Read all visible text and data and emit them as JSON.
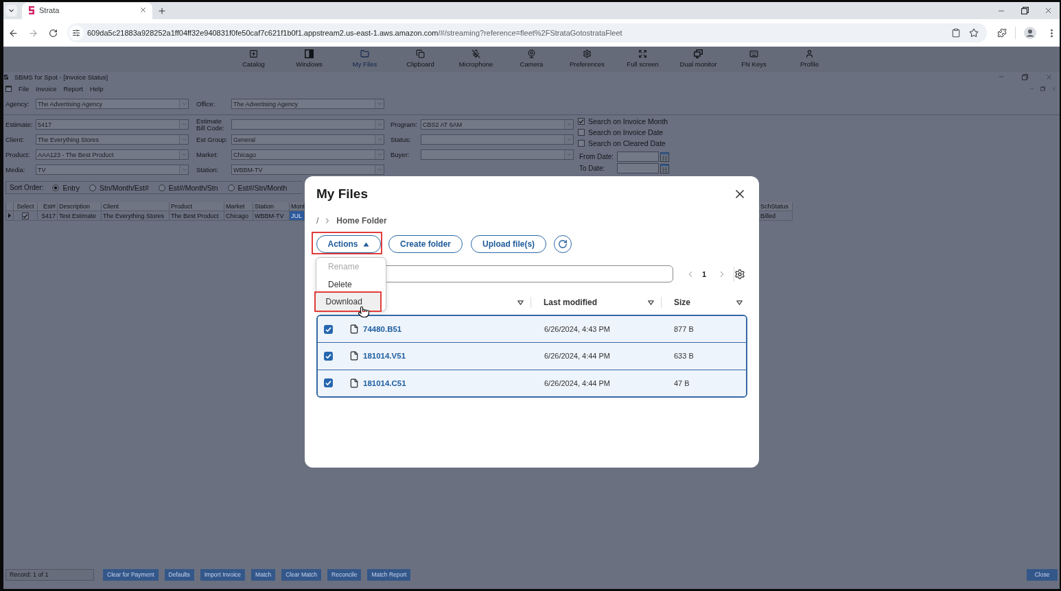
{
  "browser": {
    "tab_title": "Strata",
    "url_host": "609da5c21883a928252a1ff04ff32e940831f0fe50caf7c621f1b0f1.appstream2.us-east-1.aws.amazon.com",
    "url_path": "/#/streaming?reference=fleet%2FStrataGotostrataFleet"
  },
  "streaming_toolbar": [
    {
      "label": "Catalog",
      "selected": false
    },
    {
      "label": "Windows",
      "selected": false
    },
    {
      "label": "My Files",
      "selected": true
    },
    {
      "label": "Clipboard",
      "selected": false
    },
    {
      "label": "Microphone",
      "selected": false
    },
    {
      "label": "Camera",
      "selected": false
    },
    {
      "label": "Preferences",
      "selected": false
    },
    {
      "label": "Full screen",
      "selected": false
    },
    {
      "label": "Dual monitor",
      "selected": false
    },
    {
      "label": "FN Keys",
      "selected": false
    },
    {
      "label": "Profile",
      "selected": false
    }
  ],
  "app_window": {
    "title": "SBMS for Spot - [Invoice Status]",
    "menu": [
      "File",
      "Invoice",
      "Report",
      "Help"
    ]
  },
  "filters": {
    "top_row": [
      {
        "label": "Agency:",
        "value": "The Advertising Agency"
      },
      {
        "label": "Office:",
        "value": "The Advertising Agency"
      }
    ],
    "field_columns": [
      [
        {
          "label": "Estimate:",
          "value": "5417"
        },
        {
          "label": "Client:",
          "value": "The Everything Stores"
        },
        {
          "label": "Product:",
          "value": "AAA123 - The Best Product"
        },
        {
          "label": "Media:",
          "value": "TV"
        }
      ],
      [
        {
          "label": "Estimate Bill Code:"
        },
        {
          "label": "Est Group:",
          "value": "General"
        },
        {
          "label": "Market:",
          "value": "Chicago"
        },
        {
          "label": "Station:",
          "value": "WBBM-TV"
        }
      ],
      [
        {
          "label": "Program:",
          "value": "CBS2 AT 6AM"
        },
        {
          "label": "Status:"
        },
        {
          "label": "Buyer:"
        }
      ]
    ],
    "search_options": [
      {
        "label": "Search on Invoice Month",
        "checked": true
      },
      {
        "label": "Search on Invoice Date",
        "checked": false
      },
      {
        "label": "Search on Cleared Date",
        "checked": false
      }
    ],
    "date_fields": [
      {
        "label": "From Date:"
      },
      {
        "label": "To Date:"
      }
    ]
  },
  "sort_order": {
    "label": "Sort Order:",
    "options": [
      {
        "label": "Entry",
        "selected": true
      },
      {
        "label": "Stn/Month/Est#",
        "selected": false
      },
      {
        "label": "Est#/Month/Stn",
        "selected": false
      },
      {
        "label": "Est#/Stn/Month",
        "selected": false
      }
    ]
  },
  "grid": {
    "columns": [
      "Select",
      "Est#",
      "Description",
      "Client",
      "Product",
      "Market",
      "Station",
      "Mont",
      "SchStatus"
    ],
    "rows": [
      {
        "current": true,
        "cells": [
          {
            "kind": "checkbox",
            "checked": true,
            "selected": false
          },
          {
            "kind": "text",
            "text": "5417",
            "selected": false
          },
          {
            "kind": "text",
            "text": "Test Estimate",
            "selected": false
          },
          {
            "kind": "text",
            "text": "The Everything Stores",
            "selected": false
          },
          {
            "kind": "text",
            "text": "The Best Product",
            "selected": false
          },
          {
            "kind": "text",
            "text": "Chicago",
            "selected": false
          },
          {
            "kind": "text",
            "text": "WBBM-TV",
            "selected": false
          },
          {
            "kind": "text",
            "text": "JUL",
            "selected": true
          },
          {
            "kind": "text",
            "text": "Billed",
            "selected": false
          }
        ]
      }
    ]
  },
  "footer": {
    "record": "Record: 1 of 1",
    "buttons": [
      "Clear for Payment",
      "Defaults",
      "Import Invoice",
      "Match",
      "Clear Match",
      "Reconcile",
      "Match Report"
    ],
    "close": "Close"
  },
  "dialog": {
    "title": "My Files",
    "breadcrumb": {
      "root": "/",
      "items": [
        "Home Folder"
      ]
    },
    "actions": {
      "label": "Actions",
      "expanded": true,
      "highlighted": true
    },
    "buttons": [
      "Create folder",
      "Upload file(s)"
    ],
    "menu": [
      {
        "label": "Rename",
        "disabled": true,
        "hovered": false,
        "highlighted": false
      },
      {
        "label": "Delete",
        "disabled": false,
        "hovered": false,
        "highlighted": false
      },
      {
        "label": "Download",
        "disabled": false,
        "hovered": true,
        "highlighted": true
      }
    ],
    "pagination": {
      "page": "1"
    },
    "table": {
      "columns": [
        {
          "sortable": true
        },
        {
          "label": "Last modified",
          "sortable": true
        },
        {
          "label": "Size",
          "sortable": true
        }
      ],
      "rows": [
        {
          "name": "74480.B51",
          "modified": "6/26/2024, 4:43 PM",
          "size": "877 B",
          "checked": true
        },
        {
          "name": "181014.V51",
          "modified": "6/26/2024, 4:44 PM",
          "size": "633 B",
          "checked": true
        },
        {
          "name": "181014.C51",
          "modified": "6/26/2024, 4:44 PM",
          "size": "47 B",
          "checked": true
        }
      ]
    }
  }
}
